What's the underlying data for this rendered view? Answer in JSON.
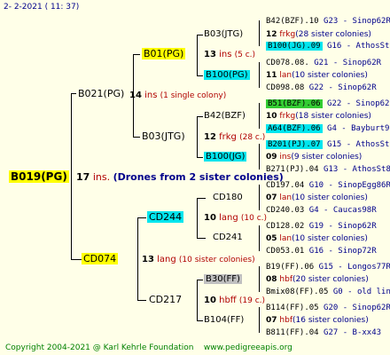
{
  "date": "2-  2-2021  ( 11:  37)",
  "root": {
    "id": "B019(PG)",
    "num": "17",
    "ins": "ins.",
    "note": "(Drones from 2 sister colonies)"
  },
  "gen1": [
    {
      "id": "B021(PG)",
      "num": "14",
      "ins": "ins",
      "note": "(1 single colony)"
    },
    {
      "id": "CD074",
      "num": "13",
      "ins": "lang",
      "note": "(10 sister colonies)"
    }
  ],
  "gen2": [
    {
      "id": "B01(PG)",
      "num": "13",
      "ins": "ins",
      "note": "(5 c.)"
    },
    {
      "id": "B03(JTG)",
      "num": "12",
      "ins": "frkg",
      "note": "(28 c.)"
    },
    {
      "id": "CD244",
      "num": "10",
      "ins": "lang",
      "note": "(10 c.)"
    },
    {
      "id": "CD217",
      "num": "10",
      "ins": "hbff",
      "note": "(19 c.)"
    }
  ],
  "gen3": [
    {
      "id": "B03(JTG)",
      "num": "12",
      "ins": "frkg",
      "note": "(28 sister colonies)"
    },
    {
      "id": "B100(PG)",
      "num": "11",
      "ins": "lan",
      "note": "(10 sister colonies)"
    },
    {
      "id": "B42(BZF)",
      "num": "10",
      "ins": "frkg",
      "note": "(18 sister colonies)"
    },
    {
      "id": "B100(JG)",
      "num": "09",
      "ins": "ins",
      "note": "(9 sister colonies)"
    },
    {
      "id": "CD180",
      "num": "07",
      "ins": "lan",
      "note": "(10 sister colonies)"
    },
    {
      "id": "CD241",
      "num": "05",
      "ins": "lan",
      "note": "(10 sister colonies)"
    },
    {
      "id": "B30(FF)",
      "num": "08",
      "ins": "hbf",
      "note": "(20 sister colonies)"
    },
    {
      "id": "B104(FF)",
      "num": "07",
      "ins": "hbf",
      "note": "(16 sister colonies)"
    }
  ],
  "gen4": [
    {
      "id": "B42(BZF).10",
      "place": "G23 - Sinop62R"
    },
    {
      "id": "B100(JG).09",
      "place": "G16 - AthosSt80R"
    },
    {
      "id": "CD078.08.",
      "place": "G21 - Sinop62R"
    },
    {
      "id": "CD098.08",
      "place": "G22 - Sinop62R"
    },
    {
      "id": "B51(BZF).06",
      "place": "G22 - Sinop62R"
    },
    {
      "id": "A64(BZF).06",
      "place": "G4 - Bayburt98-3"
    },
    {
      "id": "B201(PJ).07",
      "place": "G15 - AthosSt80R"
    },
    {
      "id": "B271(PJ).04",
      "place": "G13 - AthosSt80R"
    },
    {
      "id": "CD197.04",
      "place": "G10 - SinopEgg86R"
    },
    {
      "id": "CD240.03",
      "place": "G4 - Caucas98R"
    },
    {
      "id": "CD128.02",
      "place": "G19 - Sinop62R"
    },
    {
      "id": "CD053.01",
      "place": "G16 - Sinop72R"
    },
    {
      "id": "B19(FF).06",
      "place": "G15 - Longos77R"
    },
    {
      "id": "Bmix08(FF).05",
      "place": "G0 - old lines B"
    },
    {
      "id": "B114(FF).05",
      "place": "G20 - Sinop62R"
    },
    {
      "id": "B811(FF).04",
      "place": "G27 - B-xx43"
    }
  ],
  "footer": {
    "copyright": "Copyright 2004-2021 @ Karl Kehrle Foundation",
    "site": "www.pedigreeapis.org"
  }
}
